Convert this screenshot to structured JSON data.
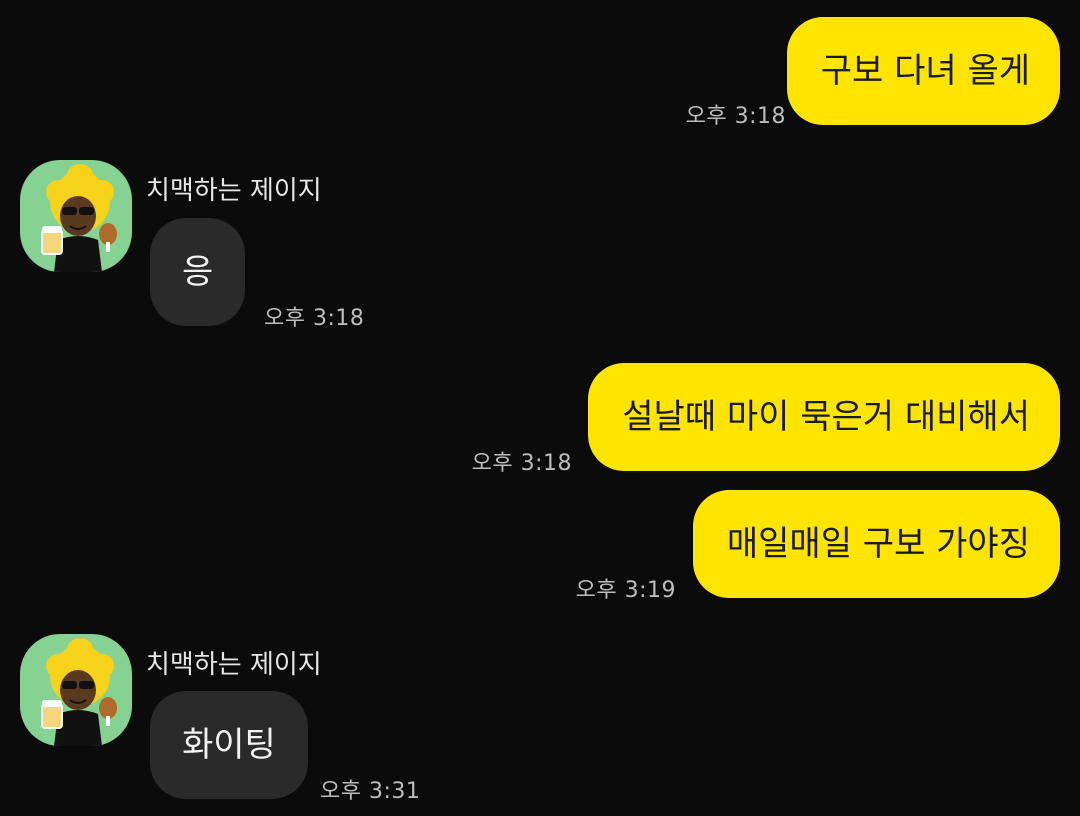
{
  "messages": [
    {
      "direction": "out",
      "text": "구보 다녀 올게",
      "time": "오후 3:18"
    },
    {
      "direction": "in",
      "sender": "치맥하는 제이지",
      "text": "응",
      "time": "오후 3:18",
      "avatar": "jayg-avatar-icon"
    },
    {
      "direction": "out",
      "text": "설날때 마이 묵은거 대비해서",
      "time": "오후 3:18"
    },
    {
      "direction": "out",
      "text": "매일매일 구보 가야징",
      "time": "오후 3:19"
    },
    {
      "direction": "in",
      "sender": "치맥하는 제이지",
      "text": "화이팅",
      "time": "오후 3:31",
      "avatar": "jayg-avatar-icon"
    }
  ],
  "colors": {
    "background": "#0b0b0b",
    "outgoing_bubble": "#fee500",
    "incoming_bubble": "#2a2a2a",
    "avatar_bg": "#86d293",
    "timestamp": "#bdbdbd"
  }
}
